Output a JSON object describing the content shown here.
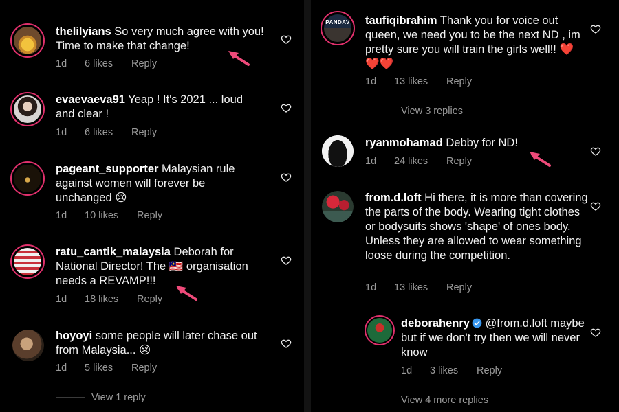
{
  "colors": {
    "ring": "#e1306c",
    "muted": "#9a9a9a",
    "arrow": "#ef4a7a",
    "verified": "#3897f0",
    "heart_emoji": "#e0245e"
  },
  "left_comments": [
    {
      "username": "thelilyians",
      "text": "So very much agree with you! Time to make that change!",
      "time": "1d",
      "likes": "6 likes",
      "reply": "Reply"
    },
    {
      "username": "evaevaeva91",
      "text": "Yeap ! It's 2021 ... loud and clear !",
      "time": "1d",
      "likes": "6 likes",
      "reply": "Reply"
    },
    {
      "username": "pageant_supporter",
      "text": "Malaysian rule against women will forever be unchanged",
      "emoji": "😢",
      "time": "1d",
      "likes": "10 likes",
      "reply": "Reply"
    },
    {
      "username": "ratu_cantik_malaysia",
      "text_before": "Deborah for National Director! The",
      "flag_emoji": "🇲🇾",
      "text_after": "organisation needs a REVAMP!!!",
      "time": "1d",
      "likes": "18 likes",
      "reply": "Reply"
    },
    {
      "username": "hoyoyi",
      "text": "some people will later chase out from Malaysia...",
      "emoji": "😢",
      "time": "1d",
      "likes": "5 likes",
      "reply": "Reply"
    }
  ],
  "left_view_replies": "View 1 reply",
  "right_comments": [
    {
      "username": "taufiqibrahim",
      "text": "Thank you for voice out queen, we need you to be the next ND , im pretty sure you will train the girls well!!",
      "hearts": "❤️❤️❤️",
      "avatar_text": "PANDAV",
      "time": "1d",
      "likes": "13 likes",
      "reply": "Reply"
    },
    {
      "username": "ryanmohamad",
      "text": "Debby for ND!",
      "time": "1d",
      "likes": "24 likes",
      "reply": "Reply"
    },
    {
      "username": "from.d.loft",
      "text": "Hi there, it is more than covering the parts of the body. Wearing tight clothes or bodysuits shows 'shape' of ones body. Unless they are allowed to wear something loose during the competition.",
      "time": "1d",
      "likes": "13 likes",
      "reply": "Reply"
    },
    {
      "username": "deborahenry",
      "mention": "@from.d.loft",
      "text": "maybe but if we don't try then we will never know",
      "time": "1d",
      "likes": "3 likes",
      "reply": "Reply"
    }
  ],
  "right_view_replies_1": "View 3 replies",
  "right_view_replies_2": "View 4 more replies"
}
